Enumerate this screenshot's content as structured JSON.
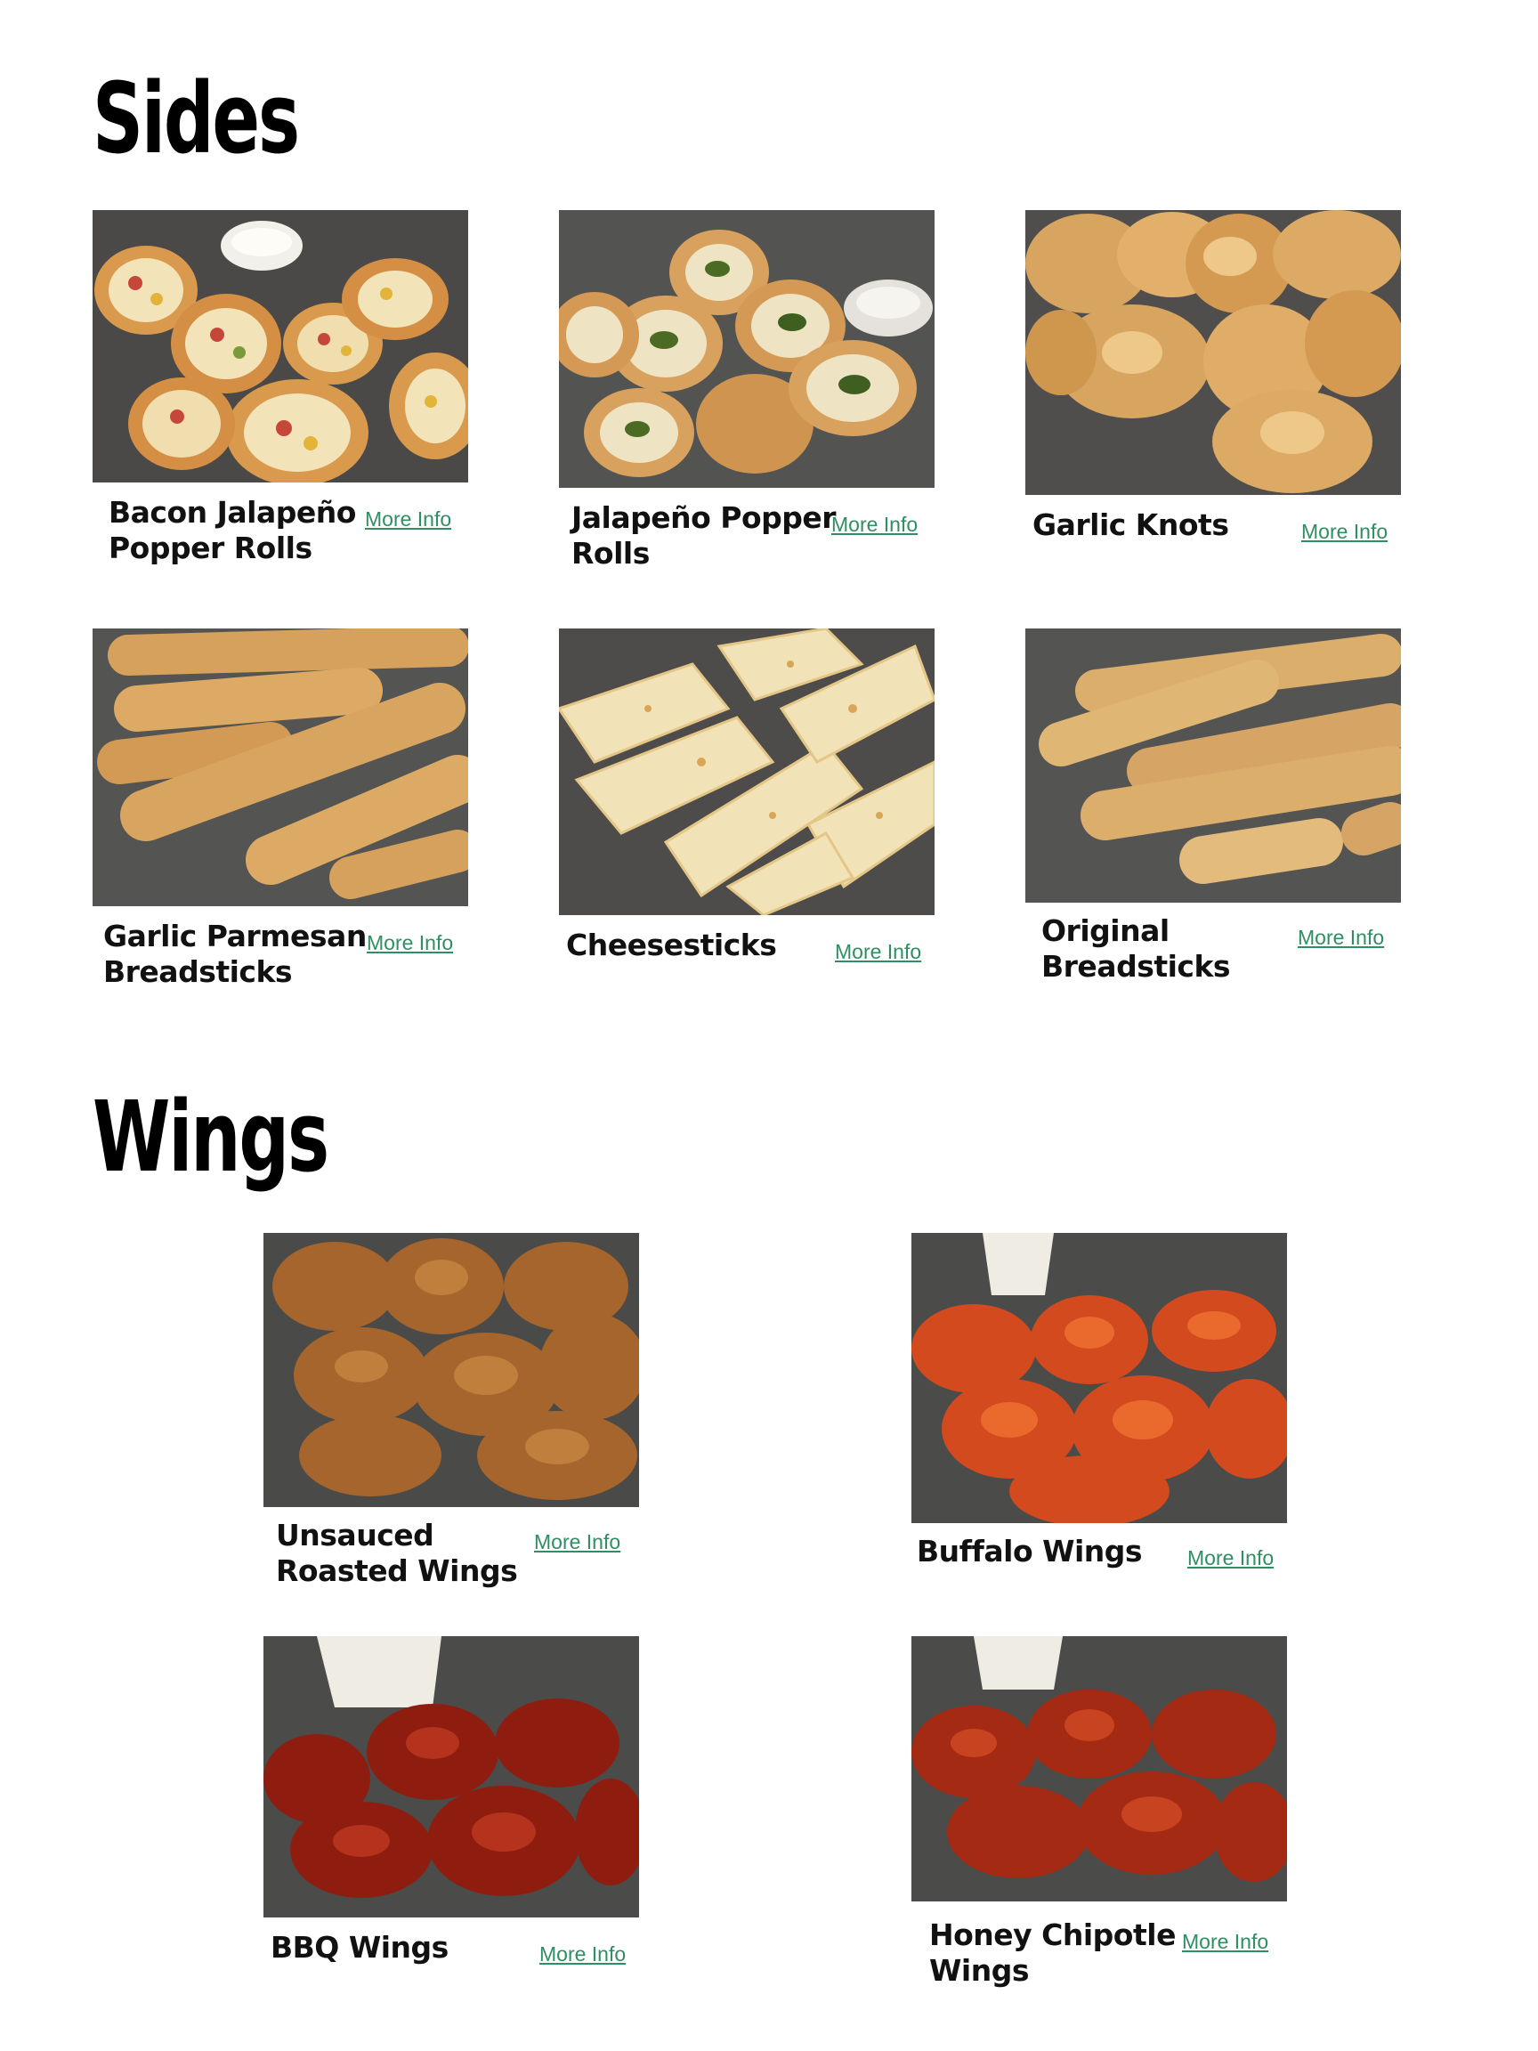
{
  "sides": {
    "title": "Sides",
    "items": [
      {
        "name": "Bacon Jalapeño Popper Rolls",
        "link": "More Info"
      },
      {
        "name": "Jalapeño Popper Rolls",
        "link": "More Info"
      },
      {
        "name": "Garlic Knots",
        "link": "More Info"
      },
      {
        "name": "Garlic Parmesan Breadsticks",
        "link": "More Info"
      },
      {
        "name": "Cheesesticks",
        "link": "More Info"
      },
      {
        "name": "Original Breadsticks",
        "link": "More Info"
      }
    ]
  },
  "wings": {
    "title": "Wings",
    "items": [
      {
        "name": "Unsauced Roasted Wings",
        "link": "More Info"
      },
      {
        "name": "Buffalo Wings",
        "link": "More Info"
      },
      {
        "name": "BBQ Wings",
        "link": "More Info"
      },
      {
        "name": "Honey Chipotle Wings",
        "link": "More Info"
      }
    ]
  },
  "colors": {
    "link": "#2f8f62",
    "photo_background": "#4c4c4a",
    "heading": "#000000"
  }
}
